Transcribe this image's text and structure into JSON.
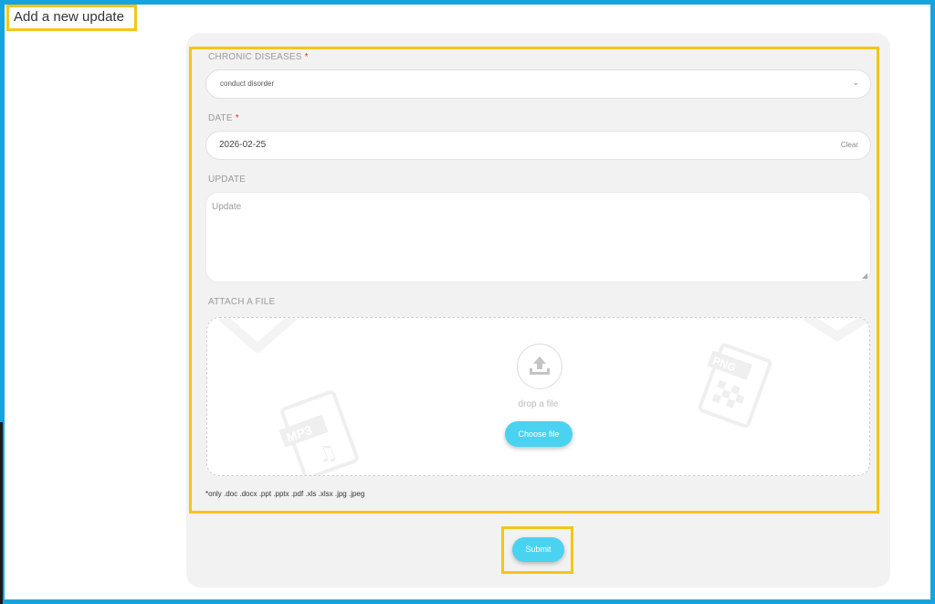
{
  "page": {
    "title": "Add a new update"
  },
  "form": {
    "chronic": {
      "label": "CHRONIC DISEASES",
      "required_mark": "*",
      "selected": "conduct disorder"
    },
    "date": {
      "label": "DATE",
      "required_mark": "*",
      "value": "2026-02-25",
      "clear_label": "Clear"
    },
    "update": {
      "label": "UPDATE",
      "placeholder": "Update"
    },
    "attach": {
      "label": "ATTACH A FILE",
      "drop_text": "drop a file",
      "choose_label": "Choose file",
      "note": "*only .doc .docx .ppt .pptx .pdf .xls .xlsx .jpg .jpeg"
    },
    "submit_label": "Submit"
  },
  "icons": {
    "chevron": "chevron-down-icon",
    "upload": "upload-icon",
    "mp3": "mp3-file-icon",
    "png": "png-file-icon"
  },
  "colors": {
    "frame_border": "#16a3e0",
    "highlight": "#f5c518",
    "button": "#49d3f0",
    "required": "#e03030"
  }
}
